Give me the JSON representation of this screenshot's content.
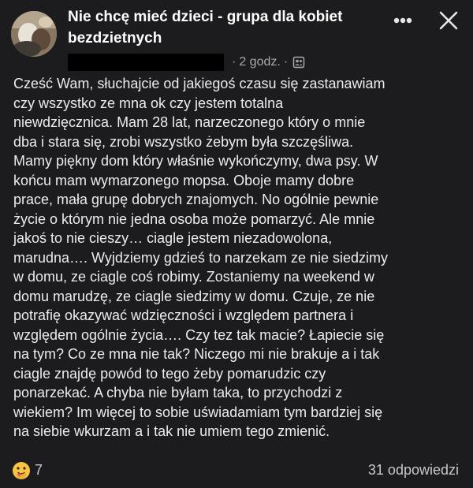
{
  "header": {
    "group_title": "Nie chcę mieć dzieci - grupa dla kobiet bezdzietnych",
    "time_ago": "2 godz.",
    "separator": "·",
    "more_icon": "more-horizontal-icon",
    "close_icon": "close-icon",
    "audience_icon": "group-members-icon"
  },
  "post": {
    "lines": [
      "Cześć Wam, słuchajcie od jakiegoś czasu się zastanawiam",
      "czy wszystko ze mna ok czy jestem totalna",
      "niewdzięcznica. Mam 28 lat, narzeczonego który o mnie",
      "dba i stara się, zrobi wszystko żebym była szczęśliwa.",
      "Mamy piękny dom który właśnie wykończymy, dwa psy. W",
      "końcu mam wymarzonego mopsa. Oboje mamy dobre",
      "prace, mała grupę dobrych znajomych. No ogólnie pewnie",
      "życie o którym nie jedna osoba może pomarzyć. Ale mnie",
      "jakoś to nie cieszy… ciagle jestem niezadowolona,",
      "marudna…. Wyjdziemy gdzieś to narzekam ze nie siedzimy",
      "w domu, ze ciagle coś robimy. Zostaniemy na weekend w",
      "domu marudzę, ze ciagle siedzimy w domu. Czuje, ze nie",
      "potrafię okazywać wdzięczności i względem partnera i",
      "względem ogólnie życia…. Czy tez tak macie? Łapiecie się",
      "na tym? Co ze mna nie tak? Niczego mi nie brakuje a i tak",
      "ciagle znajdę powód to tego żeby pomarudzic czy",
      "ponarzekać. A chyba nie byłam taka, to przychodzi z",
      "wiekiem? Im więcej to sobie uświadamiam tym bardziej się",
      "na siebie wkurzam a i tak nie umiem tego zmienić."
    ]
  },
  "footer": {
    "reaction_icon": "care-reaction-icon",
    "reaction_count": "7",
    "replies": "31 odpowiedzi"
  }
}
